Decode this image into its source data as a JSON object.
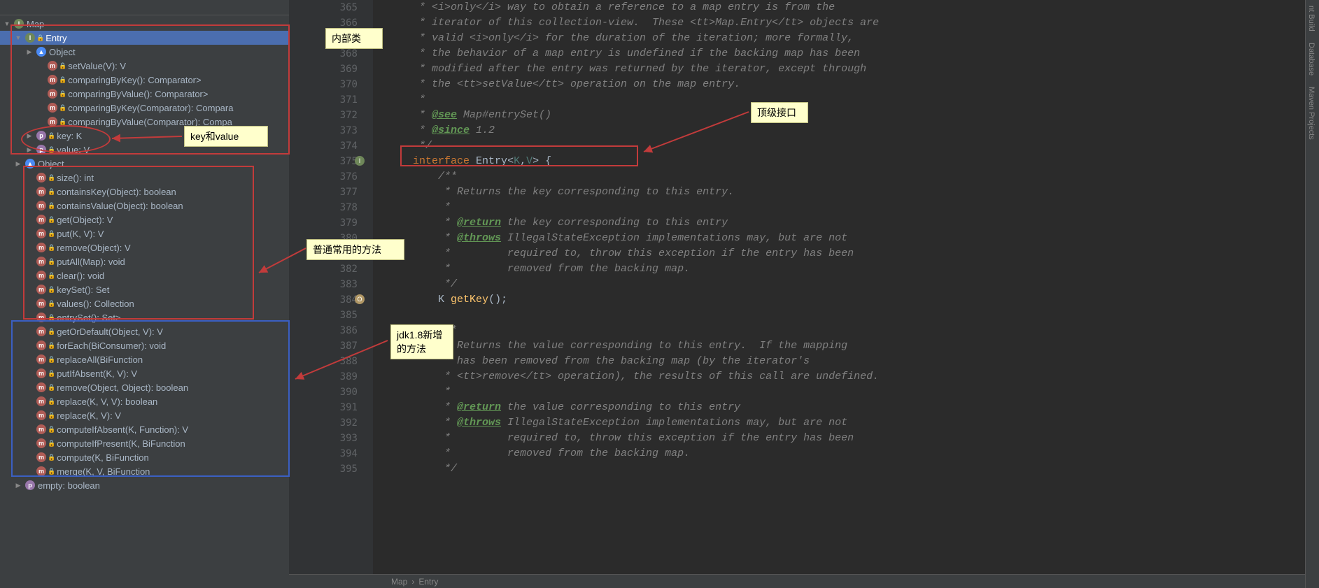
{
  "tree": {
    "root": "Map",
    "entry": "Entry",
    "object1": "Object",
    "entry_methods": [
      "setValue(V): V",
      "comparingByKey(): Comparator<Entry<K, V>>",
      "comparingByValue(): Comparator<Entry<K, V>>",
      "comparingByKey(Comparator<? super K>): Compara",
      "comparingByValue(Comparator<? super V>): Compa"
    ],
    "entry_props": [
      "key: K",
      "value: V"
    ],
    "object2": "Object",
    "map_methods_common": [
      "size(): int",
      "containsKey(Object): boolean",
      "containsValue(Object): boolean",
      "get(Object): V",
      "put(K, V): V",
      "remove(Object): V",
      "putAll(Map<? extends K, ? extends V>): void",
      "clear(): void",
      "keySet(): Set<K>",
      "values(): Collection<V>",
      "entrySet(): Set<Entry<K, V>>"
    ],
    "map_methods_jdk8": [
      "getOrDefault(Object, V): V",
      "forEach(BiConsumer<? super K, ? super V>): void",
      "replaceAll(BiFunction<? super K, ? super V, ? extends V>",
      "putIfAbsent(K, V): V",
      "remove(Object, Object): boolean",
      "replace(K, V, V): boolean",
      "replace(K, V): V",
      "computeIfAbsent(K, Function<? super K, ? extends V>): V",
      "computeIfPresent(K, BiFunction<? super K, ? super V, ? e",
      "compute(K, BiFunction<? super K, ? super V, ? extends V",
      "merge(K, V, BiFunction<? super V, ? super V, ? extends V"
    ],
    "empty_prop": "empty: boolean"
  },
  "annotations": {
    "inner_class": "内部类",
    "key_value": "key和value",
    "common_methods": "普通常用的方法",
    "jdk8_methods": "jdk1.8新增的方法",
    "top_interface": "顶级接口"
  },
  "breadcrumb": {
    "parent": "Map",
    "child": "Entry"
  },
  "right_tabs": [
    "nt Build",
    "Database",
    "Maven Projects"
  ],
  "code": {
    "line_start": 365,
    "lines": [
      "    * <i>only</i> way to obtain a reference to a map entry is from the",
      "    * iterator of this collection-view.  These <tt>Map.Entry</tt> objects are",
      "    * valid <i>only</i> for the duration of the iteration; more formally,",
      "    * the behavior of a map entry is undefined if the backing map has been",
      "    * modified after the entry was returned by the iterator, except through",
      "    * the <tt>setValue</tt> operation on the map entry.",
      "    *",
      "    * @see Map#entrySet()",
      "    * @since 1.2",
      "    */",
      "   interface Entry<K,V> {",
      "       /**",
      "        * Returns the key corresponding to this entry.",
      "        *",
      "        * @return the key corresponding to this entry",
      "        * @throws IllegalStateException implementations may, but are not",
      "        *         required to, throw this exception if the entry has been",
      "        *         removed from the backing map.",
      "        */",
      "       K getKey();",
      "",
      "       /**",
      "        * Returns the value corresponding to this entry.  If the mapping",
      "        * has been removed from the backing map (by the iterator's",
      "        * <tt>remove</tt> operation), the results of this call are undefined.",
      "        *",
      "        * @return the value corresponding to this entry",
      "        * @throws IllegalStateException implementations may, but are not",
      "        *         required to, throw this exception if the entry has been",
      "        *         removed from the backing map.",
      "        */"
    ]
  }
}
